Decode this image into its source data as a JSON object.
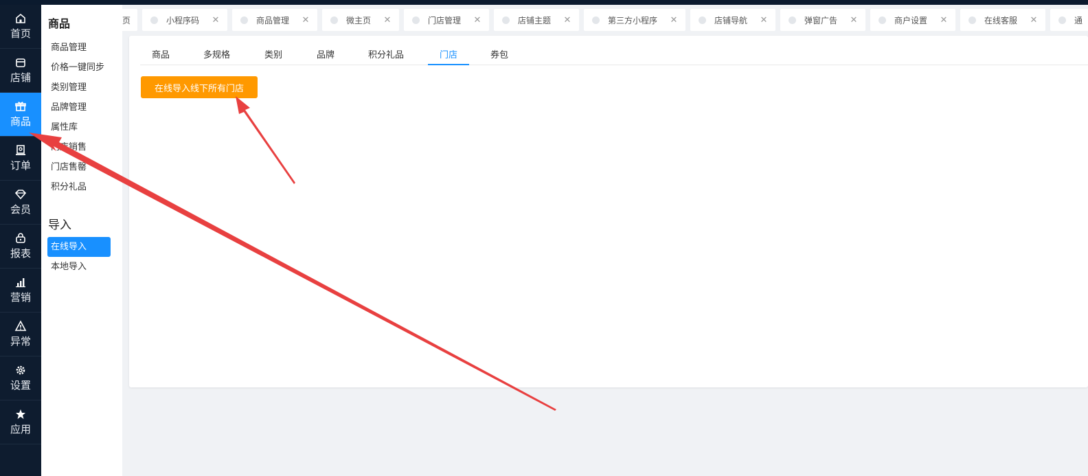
{
  "main_nav": [
    {
      "label": "首页",
      "icon": "home-icon"
    },
    {
      "label": "店铺",
      "icon": "store-icon"
    },
    {
      "label": "商品",
      "icon": "gift-icon",
      "active": true
    },
    {
      "label": "订单",
      "icon": "order-icon"
    },
    {
      "label": "会员",
      "icon": "diamond-icon"
    },
    {
      "label": "报表",
      "icon": "lock-bag-icon"
    },
    {
      "label": "营销",
      "icon": "bar-chart-icon"
    },
    {
      "label": "异常",
      "icon": "warning-icon"
    },
    {
      "label": "设置",
      "icon": "gear-icon"
    },
    {
      "label": "应用",
      "icon": "star-icon"
    }
  ],
  "sub_nav": {
    "group1_title": "商品",
    "group1_items": [
      "商品管理",
      "价格一键同步",
      "类别管理",
      "品牌管理",
      "属性库",
      "门店销售",
      "门店售罄",
      "积分礼品"
    ],
    "group2_title": "导入",
    "group2_items": [
      "在线导入",
      "本地导入"
    ],
    "active_item": "在线导入"
  },
  "tabs": [
    "页",
    "小程序码",
    "商品管理",
    "微主页",
    "门店管理",
    "店铺主题",
    "第三方小程序",
    "店铺导航",
    "弹窗广告",
    "商户设置",
    "在线客服",
    "通"
  ],
  "content": {
    "tabs": [
      "商品",
      "多规格",
      "类别",
      "品牌",
      "积分礼品",
      "门店",
      "券包"
    ],
    "active_tab": "门店",
    "import_button": "在线导入线下所有门店"
  },
  "colors": {
    "accent": "#1890ff",
    "button": "#ff9900",
    "nav_bg": "#0e1c2f",
    "annotation_arrow": "#e84040"
  }
}
